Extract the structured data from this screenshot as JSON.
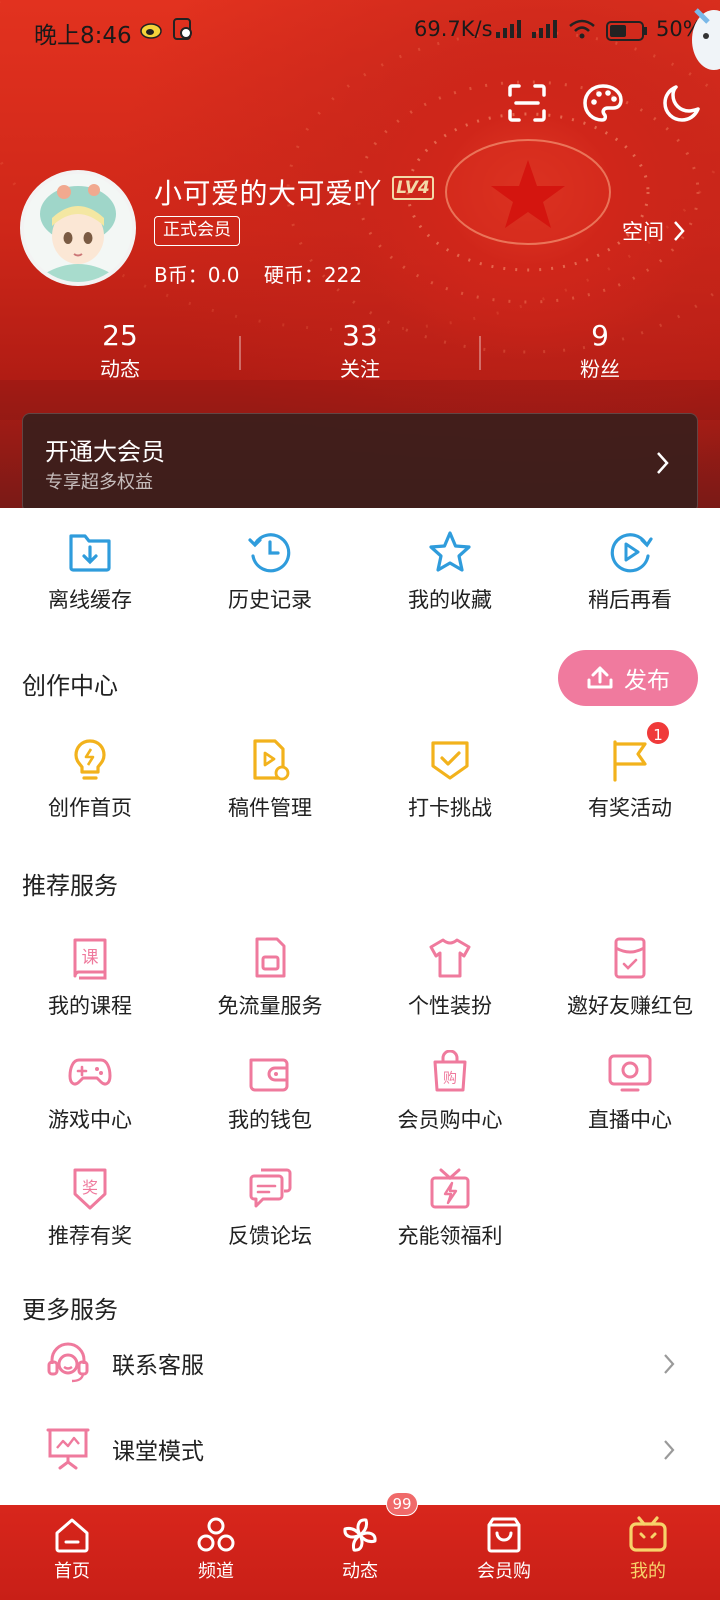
{
  "status_bar": {
    "time": "晚上8:46",
    "net_speed": "69.7K/s",
    "battery": "50%"
  },
  "header": {
    "username": "小可爱的大可爱吖",
    "level": "LV4",
    "member_tag": "正式会员",
    "b_coin": "B币：0.0",
    "hard_coin": "硬币：222",
    "space_label": "空间",
    "stats": [
      {
        "num": "25",
        "label": "动态"
      },
      {
        "num": "33",
        "label": "关注"
      },
      {
        "num": "9",
        "label": "粉丝"
      }
    ],
    "vip": {
      "title": "开通大会员",
      "subtitle": "专享超多权益"
    }
  },
  "quick_actions": [
    {
      "label": "离线缓存",
      "icon": "download-folder-icon"
    },
    {
      "label": "历史记录",
      "icon": "history-clock-icon"
    },
    {
      "label": "我的收藏",
      "icon": "star-icon"
    },
    {
      "label": "稍后再看",
      "icon": "watch-later-icon"
    }
  ],
  "creation": {
    "title": "创作中心",
    "publish_label": "发布",
    "items": [
      {
        "label": "创作首页",
        "icon": "lightbulb-icon"
      },
      {
        "label": "稿件管理",
        "icon": "manuscript-icon"
      },
      {
        "label": "打卡挑战",
        "icon": "checkin-shield-icon"
      },
      {
        "label": "有奖活动",
        "icon": "flag-icon",
        "badge": "1"
      }
    ]
  },
  "recommended": {
    "title": "推荐服务",
    "items": [
      {
        "label": "我的课程",
        "icon": "course-book-icon"
      },
      {
        "label": "免流量服务",
        "icon": "sim-card-icon"
      },
      {
        "label": "个性装扮",
        "icon": "tshirt-icon"
      },
      {
        "label": "邀好友赚红包",
        "icon": "red-packet-icon"
      },
      {
        "label": "游戏中心",
        "icon": "gamepad-icon"
      },
      {
        "label": "我的钱包",
        "icon": "wallet-icon"
      },
      {
        "label": "会员购中心",
        "icon": "shopping-bag-icon"
      },
      {
        "label": "直播中心",
        "icon": "live-tv-icon"
      },
      {
        "label": "推荐有奖",
        "icon": "reward-badge-icon"
      },
      {
        "label": "反馈论坛",
        "icon": "feedback-chat-icon"
      },
      {
        "label": "充能领福利",
        "icon": "gift-bolt-icon"
      }
    ]
  },
  "more_services": {
    "title": "更多服务",
    "items": [
      {
        "label": "联系客服",
        "icon": "headset-icon"
      },
      {
        "label": "课堂模式",
        "icon": "classroom-icon"
      }
    ]
  },
  "tabbar": {
    "dynamic_badge": "99",
    "tabs": [
      {
        "label": "首页",
        "icon": "home-icon"
      },
      {
        "label": "频道",
        "icon": "channel-icon"
      },
      {
        "label": "动态",
        "icon": "pinwheel-icon"
      },
      {
        "label": "会员购",
        "icon": "shopping-bag-icon"
      },
      {
        "label": "我的",
        "icon": "tv-mascot-icon",
        "active": true
      }
    ]
  },
  "colors": {
    "header_red": "#d0261a",
    "icon_blue": "#2f9cdc",
    "icon_yellow": "#f2b21c",
    "icon_pink": "#ef7a9d",
    "publish_pink": "#f07a9e",
    "active_tab": "#f7d36a"
  }
}
